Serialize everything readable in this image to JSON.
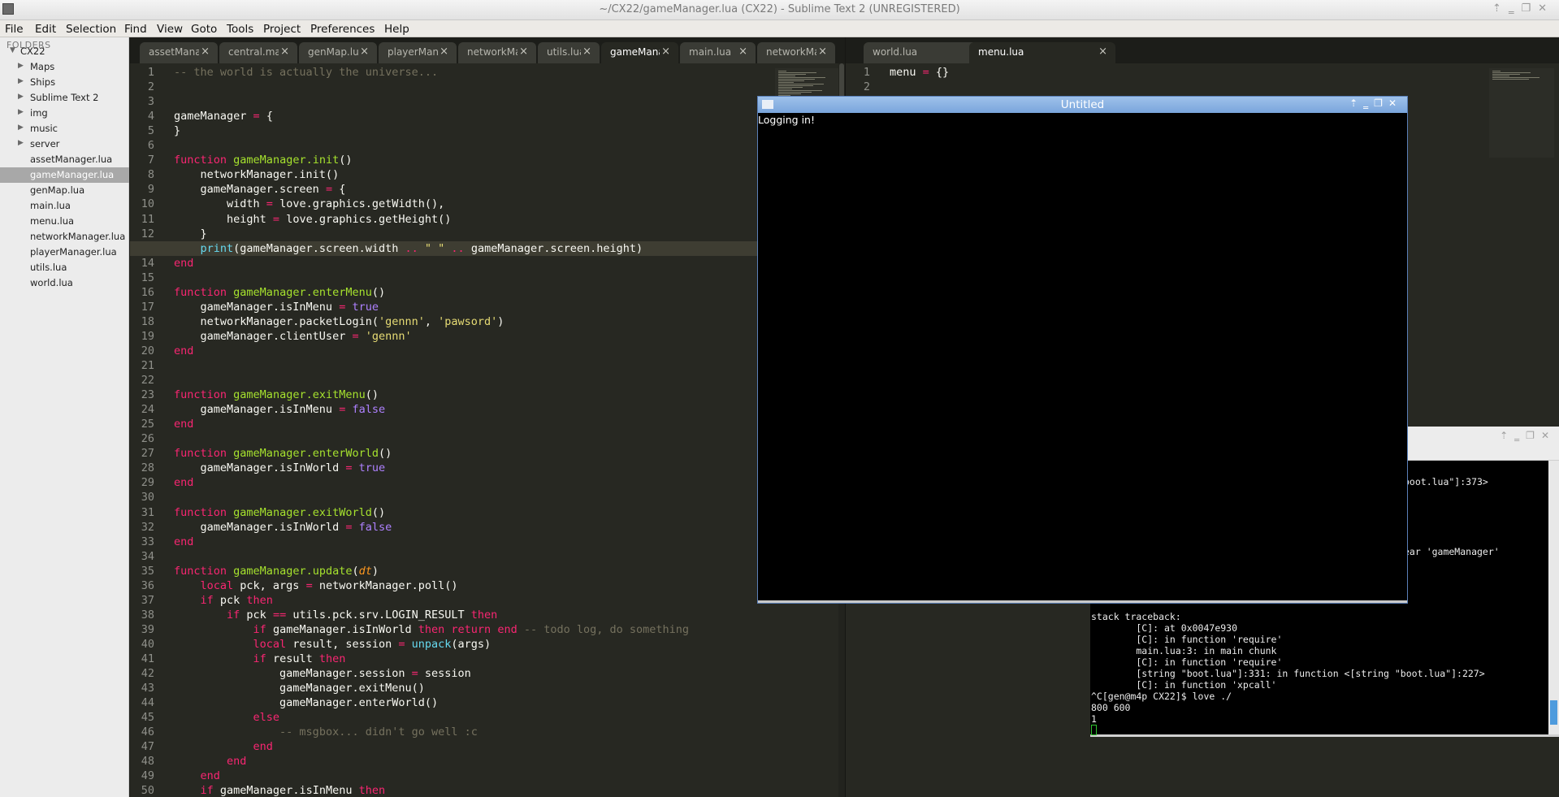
{
  "window": {
    "title": "~/CX22/gameManager.lua (CX22) - Sublime Text 2 (UNREGISTERED)"
  },
  "menubar": {
    "items": [
      "File",
      "Edit",
      "Selection",
      "Find",
      "View",
      "Goto",
      "Tools",
      "Project",
      "Preferences",
      "Help"
    ]
  },
  "sidebar": {
    "header": "FOLDERS",
    "root": "CX22",
    "folders": [
      "Maps",
      "Ships",
      "Sublime Text 2",
      "img",
      "music",
      "server"
    ],
    "files": [
      "assetManager.lua",
      "gameManager.lua",
      "genMap.lua",
      "main.lua",
      "menu.lua",
      "networkManager.lua",
      "playerManager.lua",
      "utils.lua",
      "world.lua"
    ],
    "selected": "gameManager.lua"
  },
  "left_tabs": [
    {
      "label": "assetManager.lua"
    },
    {
      "label": "central.manager"
    },
    {
      "label": "genMap.lua"
    },
    {
      "label": "playerManager.lua"
    },
    {
      "label": "networkManager.lua"
    },
    {
      "label": "utils.lua"
    },
    {
      "label": "gameManager.lua",
      "active": true
    },
    {
      "label": "main.lua"
    },
    {
      "label": "networkManager.lua"
    }
  ],
  "right_tabs": [
    {
      "label": "world.lua"
    },
    {
      "label": "menu.lua",
      "active": true
    }
  ],
  "code_left": [
    [
      [
        "c",
        "-- the world is actually the universe..."
      ]
    ],
    [],
    [],
    [
      [
        "",
        "gameManager "
      ],
      [
        "k",
        "="
      ],
      [
        "",
        " {"
      ]
    ],
    [
      [
        "",
        "}"
      ]
    ],
    [],
    [
      [
        "k",
        "function"
      ],
      [
        "",
        " "
      ],
      [
        "f",
        "gameManager.init"
      ],
      [
        "",
        "()"
      ]
    ],
    [
      [
        "",
        "    networkManager.init()"
      ]
    ],
    [
      [
        "",
        "    gameManager.screen "
      ],
      [
        "k",
        "="
      ],
      [
        "",
        " {"
      ]
    ],
    [
      [
        "",
        "        width "
      ],
      [
        "k",
        "="
      ],
      [
        "",
        " love.graphics.getWidth(),"
      ]
    ],
    [
      [
        "",
        "        height "
      ],
      [
        "k",
        "="
      ],
      [
        "",
        " love.graphics.getHeight()"
      ]
    ],
    [
      [
        "",
        "    }"
      ]
    ],
    [
      [
        "",
        "    "
      ],
      [
        "b",
        "print"
      ],
      [
        "",
        "(gameManager.screen.width "
      ],
      [
        "k",
        ".."
      ],
      [
        "",
        " "
      ],
      [
        "s",
        "\" \""
      ],
      [
        "",
        " "
      ],
      [
        "k",
        ".."
      ],
      [
        "",
        " gameManager.screen.height)"
      ]
    ],
    [
      [
        "k",
        "end"
      ]
    ],
    [],
    [
      [
        "k",
        "function"
      ],
      [
        "",
        " "
      ],
      [
        "f",
        "gameManager.enterMenu"
      ],
      [
        "",
        "()"
      ]
    ],
    [
      [
        "",
        "    gameManager.isInMenu "
      ],
      [
        "k",
        "="
      ],
      [
        "",
        " "
      ],
      [
        "n",
        "true"
      ]
    ],
    [
      [
        "",
        "    networkManager.packetLogin("
      ],
      [
        "s",
        "'gennn'"
      ],
      [
        "",
        ", "
      ],
      [
        "s",
        "'pawsord'"
      ],
      [
        "",
        ")"
      ]
    ],
    [
      [
        "",
        "    gameManager.clientUser "
      ],
      [
        "k",
        "="
      ],
      [
        "",
        " "
      ],
      [
        "s",
        "'gennn'"
      ]
    ],
    [
      [
        "k",
        "end"
      ]
    ],
    [],
    [],
    [
      [
        "k",
        "function"
      ],
      [
        "",
        " "
      ],
      [
        "f",
        "gameManager.exitMenu"
      ],
      [
        "",
        "()"
      ]
    ],
    [
      [
        "",
        "    gameManager.isInMenu "
      ],
      [
        "k",
        "="
      ],
      [
        "",
        " "
      ],
      [
        "n",
        "false"
      ]
    ],
    [
      [
        "k",
        "end"
      ]
    ],
    [],
    [
      [
        "k",
        "function"
      ],
      [
        "",
        " "
      ],
      [
        "f",
        "gameManager.enterWorld"
      ],
      [
        "",
        "()"
      ]
    ],
    [
      [
        "",
        "    gameManager.isInWorld "
      ],
      [
        "k",
        "="
      ],
      [
        "",
        " "
      ],
      [
        "n",
        "true"
      ]
    ],
    [
      [
        "k",
        "end"
      ]
    ],
    [],
    [
      [
        "k",
        "function"
      ],
      [
        "",
        " "
      ],
      [
        "f",
        "gameManager.exitWorld"
      ],
      [
        "",
        "()"
      ]
    ],
    [
      [
        "",
        "    gameManager.isInWorld "
      ],
      [
        "k",
        "="
      ],
      [
        "",
        " "
      ],
      [
        "n",
        "false"
      ]
    ],
    [
      [
        "k",
        "end"
      ]
    ],
    [],
    [
      [
        "k",
        "function"
      ],
      [
        "",
        " "
      ],
      [
        "f",
        "gameManager.update"
      ],
      [
        "",
        "("
      ],
      [
        "p",
        "dt"
      ],
      [
        "",
        ")"
      ]
    ],
    [
      [
        "",
        "    "
      ],
      [
        "k",
        "local"
      ],
      [
        "",
        " pck, args "
      ],
      [
        "k",
        "="
      ],
      [
        "",
        " networkManager.poll()"
      ]
    ],
    [
      [
        "",
        "    "
      ],
      [
        "k",
        "if"
      ],
      [
        "",
        " pck "
      ],
      [
        "k",
        "then"
      ]
    ],
    [
      [
        "",
        "        "
      ],
      [
        "k",
        "if"
      ],
      [
        "",
        " pck "
      ],
      [
        "k",
        "=="
      ],
      [
        "",
        " utils.pck.srv.LOGIN_RESULT "
      ],
      [
        "k",
        "then"
      ]
    ],
    [
      [
        "",
        "            "
      ],
      [
        "k",
        "if"
      ],
      [
        "",
        " gameManager.isInWorld "
      ],
      [
        "k",
        "then"
      ],
      [
        "",
        " "
      ],
      [
        "k",
        "return"
      ],
      [
        "",
        " "
      ],
      [
        "k",
        "end"
      ],
      [
        "",
        " "
      ],
      [
        "c",
        "-- todo log, do something"
      ]
    ],
    [
      [
        "",
        "            "
      ],
      [
        "k",
        "local"
      ],
      [
        "",
        " result, session "
      ],
      [
        "k",
        "="
      ],
      [
        "",
        " "
      ],
      [
        "b",
        "unpack"
      ],
      [
        "",
        "(args)"
      ]
    ],
    [
      [
        "",
        "            "
      ],
      [
        "k",
        "if"
      ],
      [
        "",
        " result "
      ],
      [
        "k",
        "then"
      ]
    ],
    [
      [
        "",
        "                gameManager.session "
      ],
      [
        "k",
        "="
      ],
      [
        "",
        " session"
      ]
    ],
    [
      [
        "",
        "                gameManager.exitMenu()"
      ]
    ],
    [
      [
        "",
        "                gameManager.enterWorld()"
      ]
    ],
    [
      [
        "",
        "            "
      ],
      [
        "k",
        "else"
      ]
    ],
    [
      [
        "",
        "                "
      ],
      [
        "c",
        "-- msgbox... didn't go well :c"
      ]
    ],
    [
      [
        "",
        "            "
      ],
      [
        "k",
        "end"
      ]
    ],
    [
      [
        "",
        "        "
      ],
      [
        "k",
        "end"
      ]
    ],
    [
      [
        "",
        "    "
      ],
      [
        "k",
        "end"
      ]
    ],
    [
      [
        "",
        "    "
      ],
      [
        "k",
        "if"
      ],
      [
        "",
        " gameManager.isInMenu "
      ],
      [
        "k",
        "then"
      ]
    ]
  ],
  "code_right": [
    [
      [
        "",
        "menu "
      ],
      [
        "k",
        "="
      ],
      [
        "",
        " {}"
      ]
    ],
    []
  ],
  "love_window": {
    "title": "Untitled",
    "message": "Logging in!"
  },
  "terminal": {
    "partial_lines": [
      {
        "text": ":'",
        "row": 0
      },
      {
        "text": "boot.lua\"]:373>",
        "row": 1
      },
      {
        "text": "ear 'gameManager'",
        "row": 2
      }
    ],
    "lines": [
      "stack traceback:",
      "        [C]: at 0x0047e930",
      "        [C]: in function 'require'",
      "        main.lua:3: in main chunk",
      "        [C]: in function 'require'",
      "        [string \"boot.lua\"]:331: in function <[string \"boot.lua\"]:227>",
      "        [C]: in function 'xpcall'",
      "^C[gen@m4p CX22]$ love ./",
      "800 600",
      "1"
    ]
  },
  "colors": {
    "editor_bg": "#272822",
    "keyword": "#f92672",
    "function": "#a6e22e",
    "string": "#e6db74",
    "constant": "#ae81ff",
    "comment": "#75715e",
    "builtin": "#66d9ef"
  }
}
